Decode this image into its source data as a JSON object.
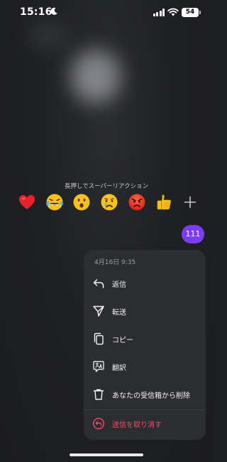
{
  "status_bar": {
    "time": "15:16",
    "battery": "54",
    "icons": [
      "moon-icon",
      "signal-icon",
      "wifi-icon",
      "battery-icon"
    ]
  },
  "reactions": {
    "hint": "長押しでスーパーリアクション",
    "emojis": [
      "heart",
      "laughing-tears",
      "surprised",
      "crying",
      "angry",
      "thumbs-up"
    ],
    "more_icon": "plus-icon"
  },
  "message": {
    "text": "111",
    "bubble_color": "#7c3cf0"
  },
  "context_menu": {
    "timestamp": "4月16日 9:35",
    "items": [
      {
        "label": "返信",
        "icon": "reply-icon"
      },
      {
        "label": "転送",
        "icon": "forward-icon"
      },
      {
        "label": "コピー",
        "icon": "copy-icon"
      },
      {
        "label": "翻訳",
        "icon": "translate-icon"
      },
      {
        "label": "あなたの受信箱から削除",
        "icon": "trash-icon"
      },
      {
        "label": "送信を取り消す",
        "icon": "unsend-icon",
        "color": "#ec4d6d"
      }
    ]
  }
}
